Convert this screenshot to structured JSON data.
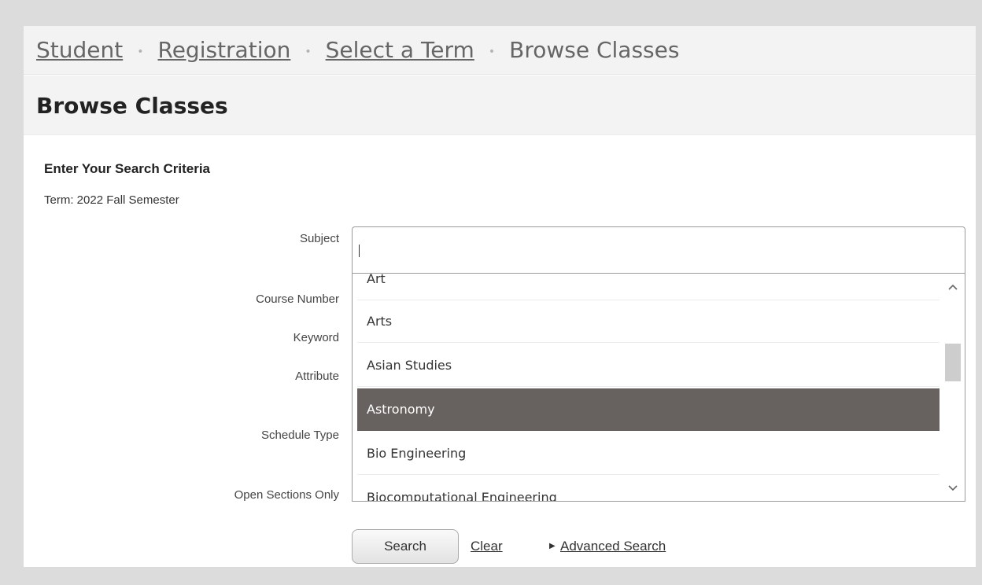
{
  "breadcrumb": {
    "items": [
      "Student",
      "Registration",
      "Select a Term"
    ],
    "current": "Browse Classes",
    "separator": "•"
  },
  "page_title": "Browse Classes",
  "search_form": {
    "section_title": "Enter Your Search Criteria",
    "term_text": "Term: 2022 Fall Semester",
    "labels": {
      "subject": "Subject",
      "course_number": "Course Number",
      "keyword": "Keyword",
      "attribute": "Attribute",
      "schedule_type": "Schedule Type",
      "open_sections_only": "Open Sections Only"
    },
    "subject_value": "",
    "subject_options": [
      "Art",
      "Arts",
      "Asian Studies",
      "Astronomy",
      "Bio Engineering",
      "Biocomputational Engineering"
    ],
    "selected_option": "Astronomy",
    "search_button": "Search",
    "clear_link": "Clear",
    "advanced_link": "Advanced Search"
  },
  "colors": {
    "background": "#dcdcdc",
    "header_bg": "#f3f3f3",
    "highlight": "#67625f"
  },
  "icons": {
    "scroll_up": "chevron-up-icon",
    "scroll_down": "chevron-down-icon",
    "advanced": "triangle-right-icon"
  }
}
